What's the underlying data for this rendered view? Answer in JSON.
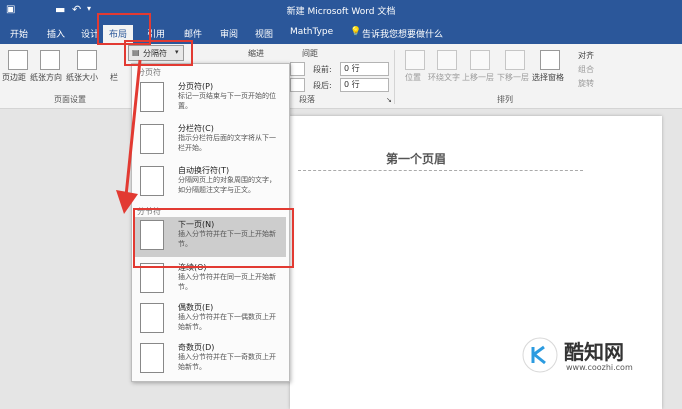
{
  "window": {
    "title": "新建 Microsoft Word 文档"
  },
  "quick_access": {
    "save_icon": "save-icon",
    "undo_icon": "undo-icon"
  },
  "tabs": [
    "开始",
    "插入",
    "设计",
    "布局",
    "引用",
    "邮件",
    "审阅",
    "视图",
    "MathType"
  ],
  "active_tab": "布局",
  "tell_me": "告诉我您想要做什么",
  "ribbon": {
    "breaks_button": "分隔符",
    "indent_label": "缩进",
    "spacing_label": "间距",
    "before_label": "段前:",
    "before_value": "0 行",
    "after_label": "段后:",
    "after_value": "0 行",
    "page_setup_buttons": [
      "页边距",
      "纸张方向",
      "纸张大小",
      "栏"
    ],
    "page_setup_group": "页面设置",
    "paragraph_group": "段落",
    "arrange_buttons": [
      "位置",
      "环绕文字",
      "上移一层",
      "下移一层",
      "选择窗格"
    ],
    "arrange_small": [
      "对齐",
      "组合",
      "旋转"
    ],
    "arrange_group": "排列"
  },
  "menu": {
    "page_breaks_header": "分页符",
    "section_breaks_header": "分节符",
    "items": [
      {
        "title": "分页符(P)",
        "desc": "标记一页结束与下一页开始的位置。"
      },
      {
        "title": "分栏符(C)",
        "desc": "指示分栏符后面的文字将从下一栏开始。"
      },
      {
        "title": "自动换行符(T)",
        "desc": "分隔网页上的对象周围的文字，如分隔题注文字与正文。"
      },
      {
        "title": "下一页(N)",
        "desc": "插入分节符并在下一页上开始新节。"
      },
      {
        "title": "连续(O)",
        "desc": "插入分节符并在同一页上开始新节。"
      },
      {
        "title": "偶数页(E)",
        "desc": "插入分节符并在下一偶数页上开始新节。"
      },
      {
        "title": "奇数页(D)",
        "desc": "插入分节符并在下一奇数页上开始新节。"
      }
    ]
  },
  "document": {
    "header_text": "第一个页眉"
  },
  "watermark": {
    "brand": "酷知网",
    "url": "www.coozhi.com"
  },
  "colors": {
    "title_bar": "#2b579a",
    "highlight_red": "#e23a32"
  }
}
